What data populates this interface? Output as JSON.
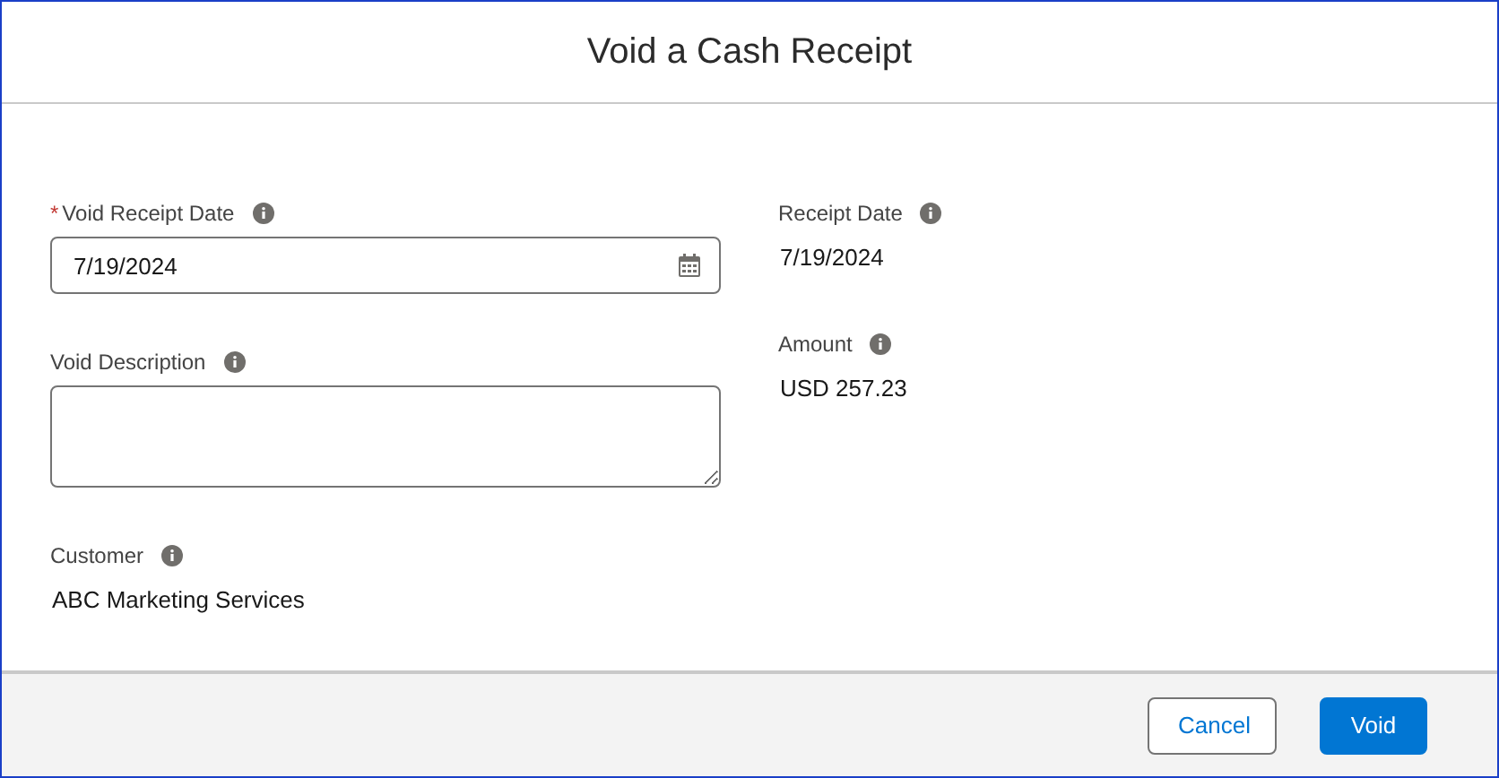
{
  "window": {
    "title": "Void a Cash Receipt"
  },
  "left_fields": [
    {
      "kind": "date-input",
      "label": "Void Receipt Date",
      "required_mark": "*",
      "value": "7/19/2024"
    },
    {
      "kind": "textarea",
      "label": "Void Description"
    },
    {
      "kind": "text",
      "label": "Customer",
      "value": "ABC Marketing Services"
    }
  ],
  "right_fields": [
    {
      "kind": "text",
      "label": "Receipt Date",
      "value": "7/19/2024"
    },
    {
      "kind": "text",
      "label": "Amount",
      "value": "USD 257.23"
    }
  ],
  "buttons": [
    {
      "kind": "neutral",
      "label": "Cancel"
    },
    {
      "kind": "brand",
      "label": "Void"
    }
  ]
}
